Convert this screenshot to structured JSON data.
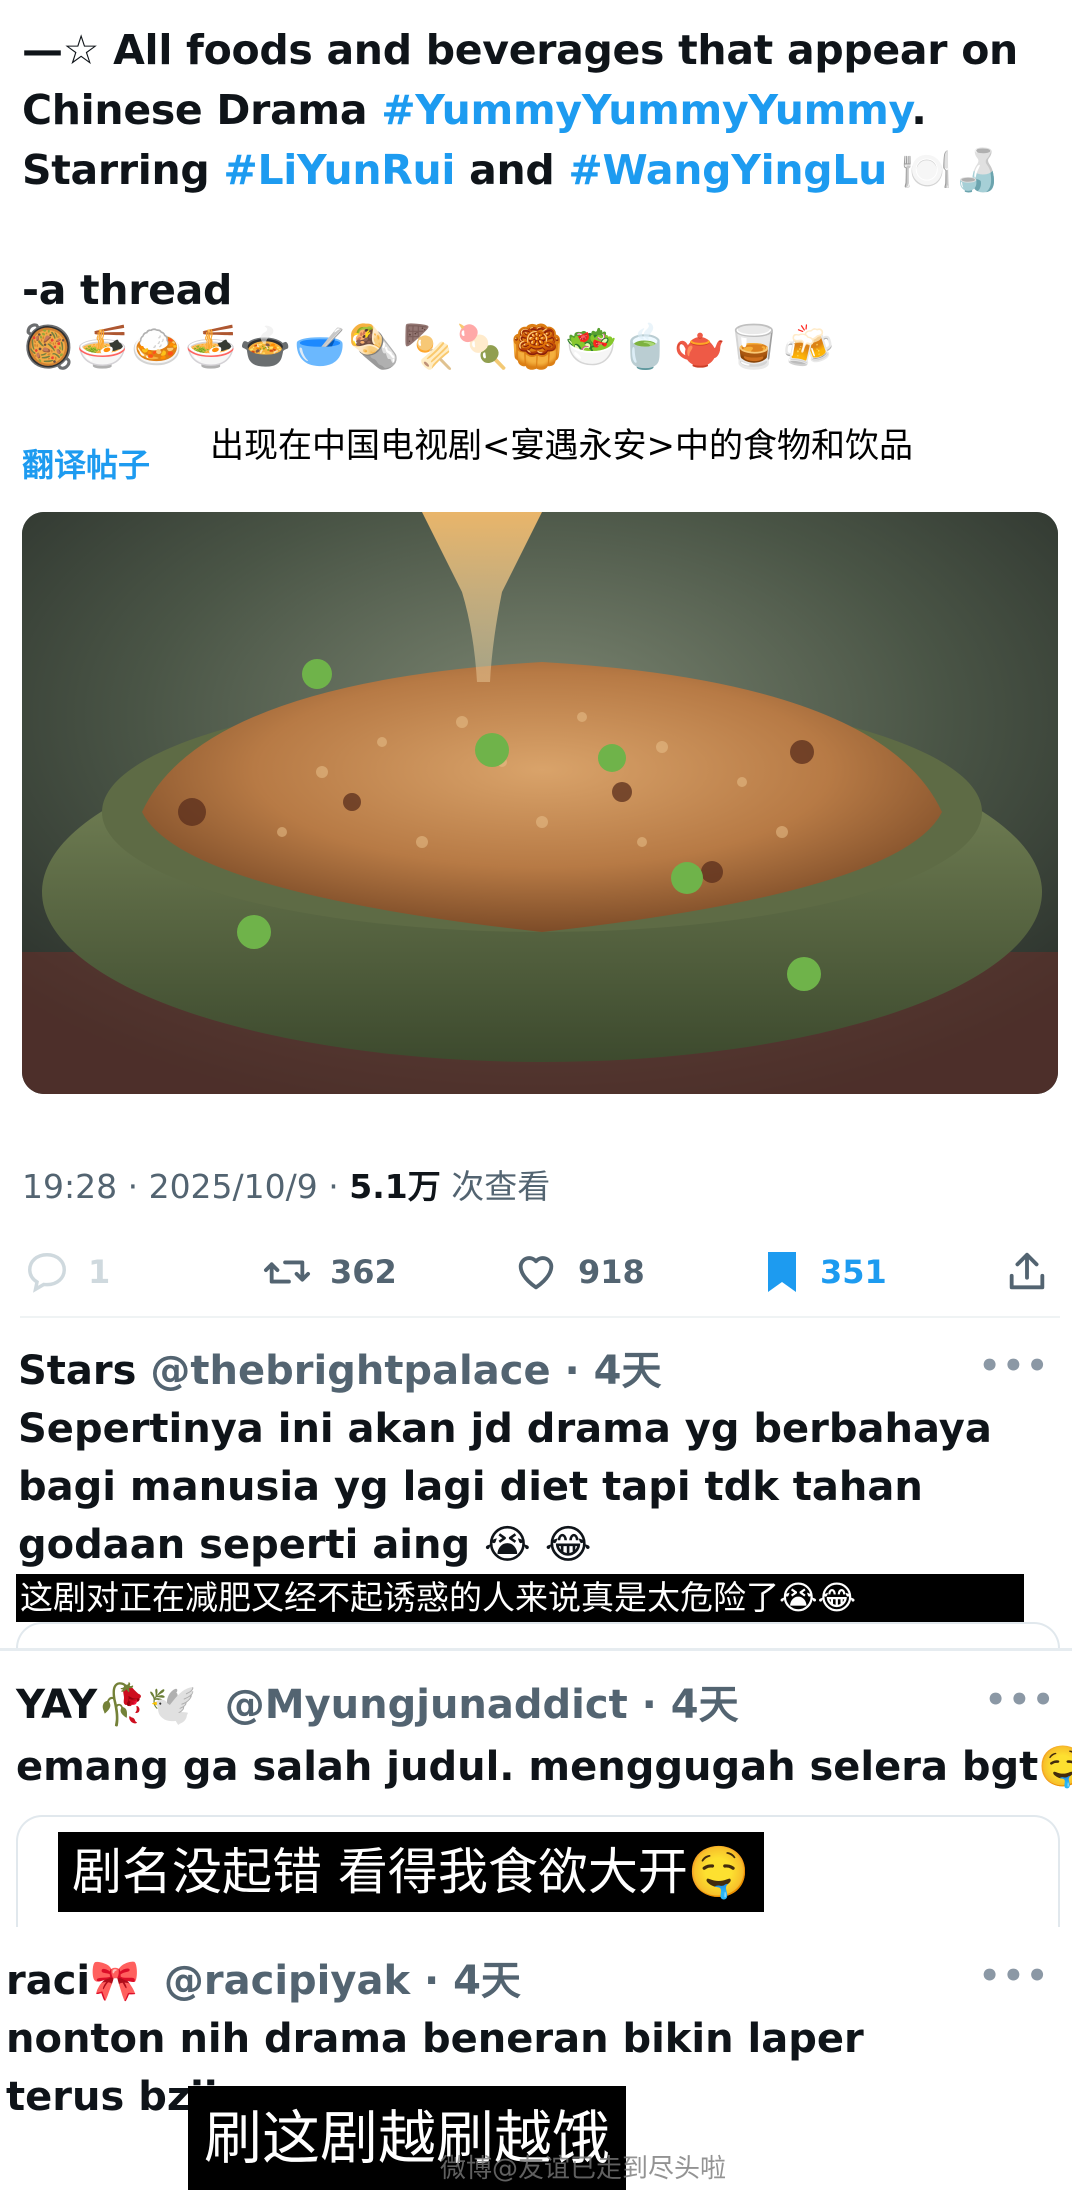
{
  "tweet": {
    "line1_prefix": "—☆ All foods and beverages that appear on",
    "line2_prefix": "Chinese Drama ",
    "line2_tag": "#YummyYummyYummy",
    "line2_suffix": ".",
    "line3_prefix": "Starring ",
    "line3_tag1": "#LiYunRui",
    "line3_mid": " and ",
    "line3_tag2": "#WangYingLu",
    "line3_emoji": " 🍽️🍶",
    "thread_label": "-a thread",
    "emoji_row": "🥘🍜🍛🍜🍲🥣🌯🍢🍡🥮🥗🍵🫖🥃🍻",
    "translate_label": "翻译帖子",
    "caption_cn": "出现在中国电视剧<宴遇永安>中的食物和饮品",
    "meta_time": "19:28 · 2025/10/9 · ",
    "meta_views": "5.1万",
    "meta_views_suffix": " 次查看",
    "stats": {
      "replies": "1",
      "reposts": "362",
      "likes": "918",
      "bookmarks": "351"
    },
    "colors": {
      "accent": "#1d9bf0",
      "muted": "#536471"
    }
  },
  "replies": [
    {
      "name": "Stars",
      "handle": "@thebrightpalace · 4天",
      "text": "Sepertinya ini akan jd drama yg berbahaya bagi manusia yg lagi diet tapi tdk tahan godaan seperti aing 😭 😂",
      "subtitle": "这剧对正在减肥又经不起诱惑的人来说真是太危险了😭😂",
      "more": "•••"
    },
    {
      "name": "YAY🥀🕊️",
      "handle": "@Myungjunaddict · 4天",
      "text": "emang ga salah judul. menggugah selera bgt🤤",
      "subtitle": "剧名没起错 看得我食欲大开🤤",
      "more": "•••"
    },
    {
      "name": "raci🎀",
      "handle": "@racipiyak · 4天",
      "text": "nonton nih drama beneran bikin laper terus bziirrr",
      "subtitle": "刷这剧越刷越饿",
      "more": "•••"
    }
  ],
  "watermark": "微博@友谊已走到尽头啦"
}
